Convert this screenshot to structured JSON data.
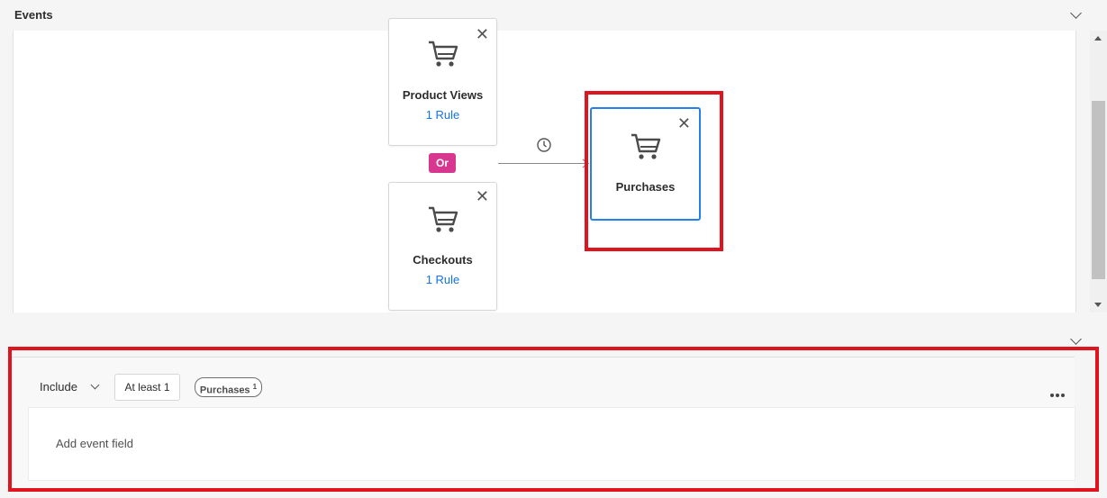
{
  "header": {
    "title": "Events",
    "collapse_icon": "chevron-down-icon"
  },
  "canvas": {
    "cards": [
      {
        "title": "Product Views",
        "rule": "1 Rule",
        "icon": "shopping-cart-icon"
      },
      {
        "title": "Checkouts",
        "rule": "1 Rule",
        "icon": "shopping-cart-icon"
      },
      {
        "title": "Purchases",
        "icon": "shopping-cart-icon",
        "selected": true
      }
    ],
    "or_badge": "Or",
    "or_color": "#d83790",
    "connector_icon": "clock-icon"
  },
  "panel": {
    "include_label": "Include",
    "at_least_label": "At least 1",
    "pill_label": "Purchases",
    "pill_superscript": "1",
    "more_icon": "more-icon",
    "add_field_label": "Add event field"
  },
  "colors": {
    "link": "#1473e6",
    "highlight": "#e0141e",
    "selected_border": "#2680eb"
  }
}
